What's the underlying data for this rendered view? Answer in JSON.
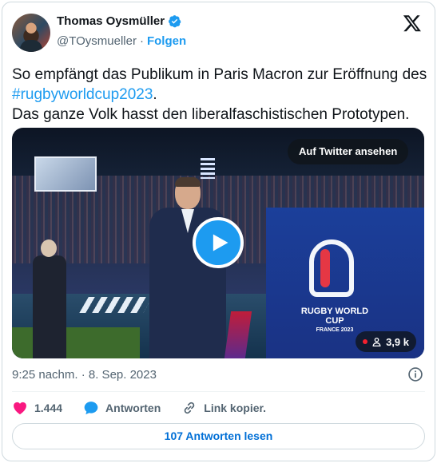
{
  "author": {
    "name": "Thomas Oysmüller",
    "handle": "@TOysmueller",
    "separator": "·",
    "follow_label": "Folgen",
    "verified": true
  },
  "tweet": {
    "text_before_hashtag": "So empfängt das Publikum in Paris Macron zur Eröffnung des ",
    "hashtag": "#rugbyworldcup2023",
    "text_after_hashtag": ".",
    "second_line": "Das ganze Volk hasst den liberalfaschistischen Prototypen."
  },
  "media": {
    "watch_label": "Auf Twitter ansehen",
    "view_count": "3,9 k",
    "overlay_logo_title": "RUGBY WORLD CUP",
    "overlay_logo_sub": "FRANCE 2023"
  },
  "meta": {
    "timestamp": "9:25 nachm. · 8. Sep. 2023"
  },
  "actions": {
    "likes": "1.444",
    "reply_label": "Antworten",
    "copy_link_label": "Link kopier."
  },
  "read_replies_label": "107 Antworten lesen",
  "colors": {
    "accent": "#1d9bf0",
    "like": "#f91880",
    "text": "#0f1419",
    "secondary": "#536471"
  },
  "icons": [
    "verified-badge-icon",
    "x-logo-icon",
    "play-icon",
    "live-dot-icon",
    "viewers-icon",
    "info-icon",
    "heart-icon",
    "reply-bubble-icon",
    "link-icon"
  ]
}
